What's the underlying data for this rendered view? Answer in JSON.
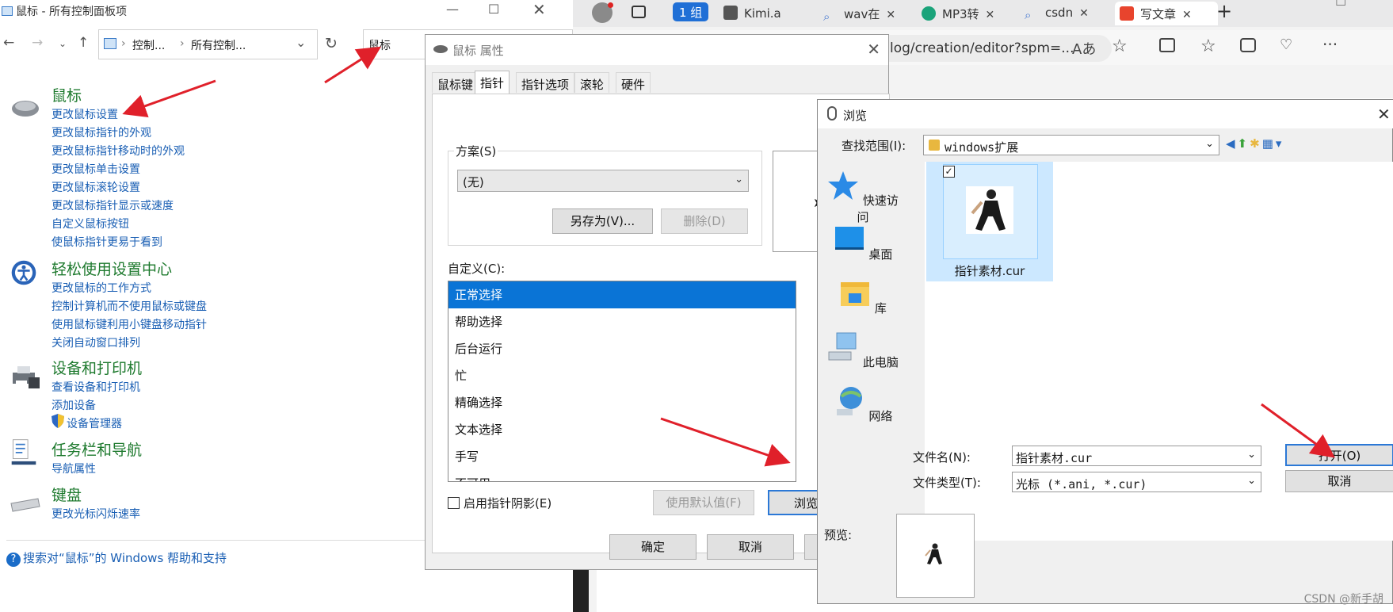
{
  "control_panel": {
    "title": "鼠标 - 所有控制面板项",
    "breadcrumb": [
      "控制...",
      "所有控制..."
    ],
    "search_value": "鼠标",
    "categories": [
      {
        "title": "鼠标",
        "links": [
          "更改鼠标设置",
          "更改鼠标指针的外观",
          "更改鼠标指针移动时的外观",
          "更改鼠标单击设置",
          "更改鼠标滚轮设置",
          "更改鼠标指针显示或速度",
          "自定义鼠标按钮",
          "使鼠标指针更易于看到"
        ]
      },
      {
        "title": "轻松使用设置中心",
        "links": [
          "更改鼠标的工作方式",
          "控制计算机而不使用鼠标或键盘",
          "使用鼠标键利用小键盘移动指针",
          "关闭自动窗口排列"
        ]
      },
      {
        "title": "设备和打印机",
        "links": [
          "查看设备和打印机",
          "添加设备",
          "设备管理器"
        ]
      },
      {
        "title": "任务栏和导航",
        "links": [
          "导航属性"
        ]
      },
      {
        "title": "键盘",
        "links": [
          "更改光标闪烁速率"
        ]
      }
    ],
    "help": "搜索对“鼠标”的 Windows 帮助和支持"
  },
  "browser": {
    "tabs": [
      {
        "label": "1 组",
        "kind": "group"
      },
      {
        "label": "Kimi.a",
        "color": "#555555"
      },
      {
        "label": "wav在",
        "color": "#4a7bd0"
      },
      {
        "label": "MP3转",
        "color": "#1aa37a"
      },
      {
        "label": "csdn",
        "color": "#4a7bd0"
      },
      {
        "label": "写文章",
        "color": "#e8442d"
      }
    ],
    "url": "log/creation/editor?spm=..."
  },
  "mouse_props": {
    "title": "鼠标 属性",
    "tabs": [
      "鼠标键",
      "指针",
      "指针选项",
      "滚轮",
      "硬件"
    ],
    "scheme_label": "方案(S)",
    "scheme_value": "(无)",
    "save_as": "另存为(V)...",
    "delete": "删除(D)",
    "custom_label": "自定义(C):",
    "pointer_list": [
      "正常选择",
      "帮助选择",
      "后台运行",
      "忙",
      "精确选择",
      "文本选择",
      "手写",
      "不可用"
    ],
    "shadow_label": "启用指针阴影(E)",
    "use_default": "使用默认值(F)",
    "browse": "浏览(B)...",
    "ok": "确定",
    "cancel": "取消"
  },
  "browse_dialog": {
    "title": "浏览",
    "look_in_label": "查找范围(I):",
    "look_in_value": "windows扩展",
    "places": [
      "快速访问",
      "桌面",
      "库",
      "此电脑",
      "网络"
    ],
    "file_name": "指针素材.cur",
    "filename_label": "文件名(N):",
    "filename_value": "指针素材.cur",
    "filetype_label": "文件类型(T):",
    "filetype_value": "光标 (*.ani, *.cur)",
    "open": "打开(O)",
    "cancel": "取消",
    "preview_label": "预览:"
  },
  "watermark": "CSDN @新手胡"
}
